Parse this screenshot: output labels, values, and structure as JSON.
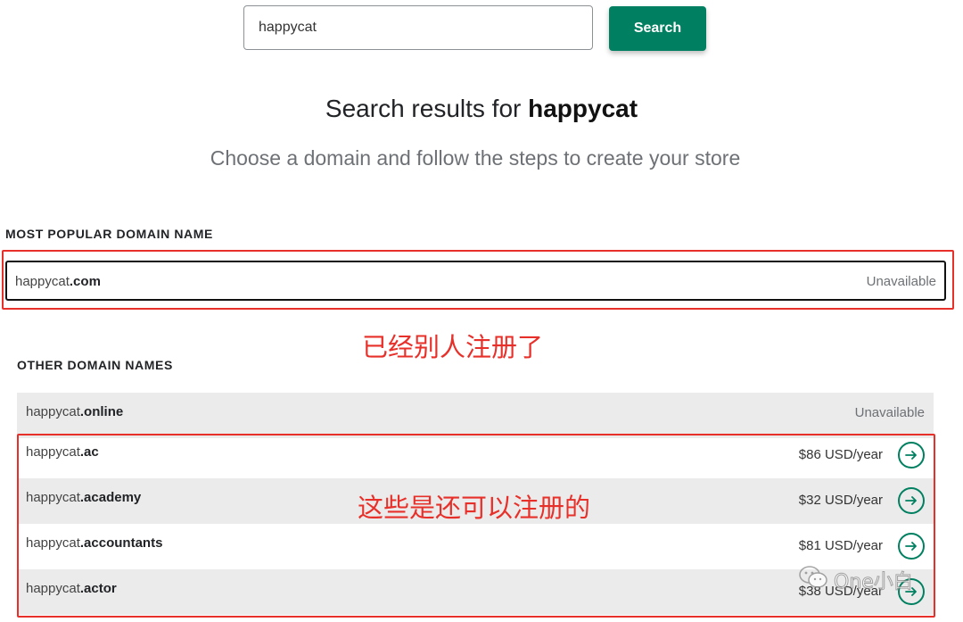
{
  "search": {
    "value": "happycat",
    "button_label": "Search"
  },
  "results": {
    "title_prefix": "Search results for ",
    "title_query": "happycat",
    "subtitle": "Choose a domain and follow the steps to create your store"
  },
  "popular": {
    "label": "MOST POPULAR DOMAIN NAME",
    "name": "happycat",
    "tld": ".com",
    "status": "Unavailable"
  },
  "other": {
    "label": "OTHER DOMAIN NAMES",
    "rows": [
      {
        "name": "happycat",
        "tld": ".online",
        "status": "Unavailable"
      },
      {
        "name": "happycat",
        "tld": ".ac",
        "price": "$86 USD/year"
      },
      {
        "name": "happycat",
        "tld": ".academy",
        "price": "$32 USD/year"
      },
      {
        "name": "happycat",
        "tld": ".accountants",
        "price": "$81 USD/year"
      },
      {
        "name": "happycat",
        "tld": ".actor",
        "price": "$38 USD/year"
      }
    ]
  },
  "annotations": {
    "registered": "已经别人注册了",
    "available": "这些是还可以注册的"
  },
  "watermark": {
    "text": "One小白"
  },
  "colors": {
    "brand_green": "#008060",
    "annotation_red": "#e8302a",
    "row_grey": "#ebebeb"
  }
}
